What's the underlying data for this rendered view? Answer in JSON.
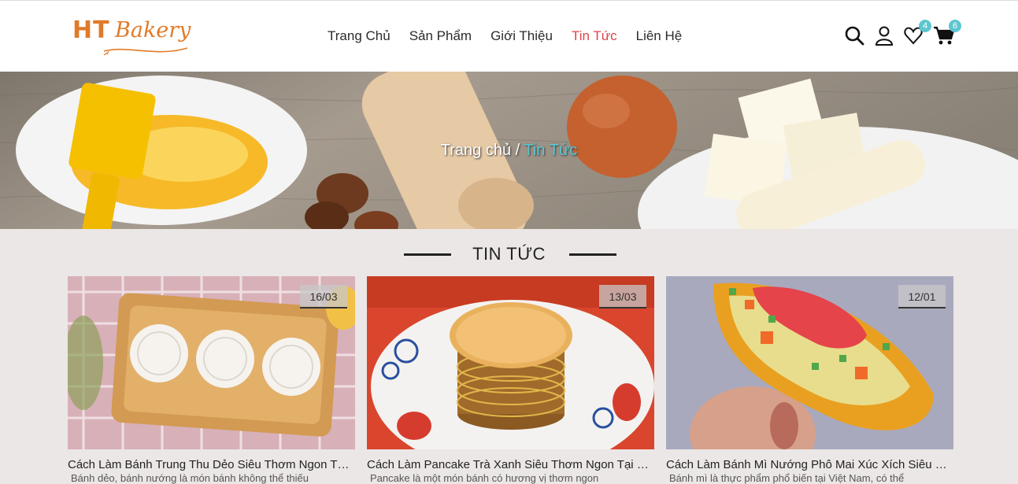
{
  "brand": {
    "logo_text_1": "HT",
    "logo_text_2": "Bakery",
    "accent": "#e07b2a"
  },
  "nav": {
    "items": [
      {
        "label": "Trang Chủ"
      },
      {
        "label": "Sản Phẩm"
      },
      {
        "label": "Giới Thiệu"
      },
      {
        "label": "Tin Tức",
        "active": true
      },
      {
        "label": "Liên Hệ"
      }
    ],
    "active_color": "#e0434b"
  },
  "header_icons": {
    "search": "search-icon",
    "account": "user-icon",
    "wishlist": "heart-icon",
    "wishlist_count": "4",
    "cart": "cart-icon",
    "cart_count": "6",
    "badge_color": "#5cc6d1"
  },
  "hero": {
    "breadcrumb_home": "Trang chủ",
    "breadcrumb_sep": " / ",
    "breadcrumb_current": "Tin Tức"
  },
  "section": {
    "title": "TIN TỨC"
  },
  "posts": [
    {
      "date": "16/03",
      "title": "Cách Làm Bánh Trung Thu Dẻo Siêu Thơm Ngon Tại Nhà",
      "desc": "Bánh dẻo, bánh nướng là món bánh không thể thiếu"
    },
    {
      "date": "13/03",
      "title": "Cách Làm Pancake Trà Xanh Siêu Thơm Ngon Tại Nhà",
      "desc": "Pancake là một món bánh có hương vị thơm ngon"
    },
    {
      "date": "12/01",
      "title": "Cách Làm Bánh Mì Nướng Phô Mai Xúc Xích Siêu Ngon",
      "desc": "Bánh mì là thực phẩm phổ biến tại Việt Nam, có thể"
    }
  ]
}
